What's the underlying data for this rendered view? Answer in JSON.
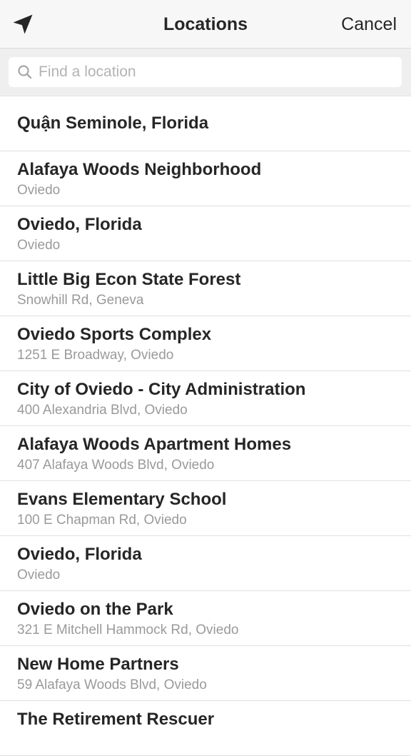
{
  "nav": {
    "location_icon": "location-arrow-icon",
    "title": "Locations",
    "cancel": "Cancel"
  },
  "search": {
    "icon": "search-icon",
    "placeholder": "Find a location",
    "value": ""
  },
  "list": {
    "first": "Quận Seminole, Florida",
    "items": [
      {
        "title": "Alafaya Woods Neighborhood",
        "sub": "Oviedo"
      },
      {
        "title": "Oviedo, Florida",
        "sub": "Oviedo"
      },
      {
        "title": "Little Big Econ State Forest",
        "sub": "Snowhill Rd, Geneva"
      },
      {
        "title": "Oviedo Sports Complex",
        "sub": "1251 E Broadway, Oviedo"
      },
      {
        "title": "City of Oviedo - City Administration",
        "sub": "400 Alexandria Blvd, Oviedo"
      },
      {
        "title": "Alafaya Woods Apartment Homes",
        "sub": "407 Alafaya Woods Blvd, Oviedo"
      },
      {
        "title": "Evans Elementary School",
        "sub": "100 E Chapman Rd, Oviedo"
      },
      {
        "title": "Oviedo, Florida",
        "sub": "Oviedo"
      },
      {
        "title": "Oviedo on the Park",
        "sub": "321 E Mitchell Hammock Rd, Oviedo"
      },
      {
        "title": "New Home Partners",
        "sub": "59 Alafaya Woods Blvd, Oviedo"
      },
      {
        "title": "The Retirement Rescuer",
        "sub": ""
      }
    ]
  }
}
